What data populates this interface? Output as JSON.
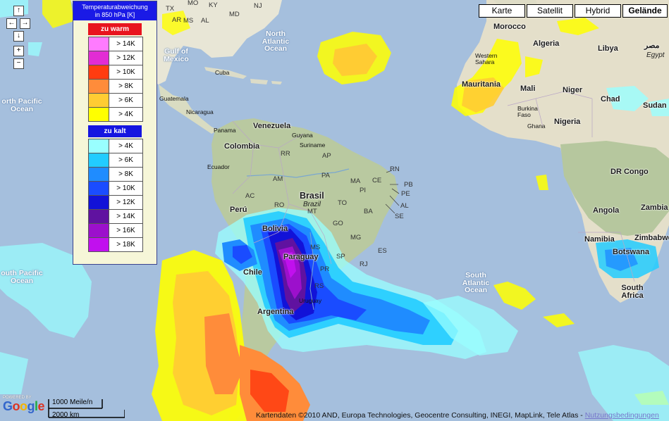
{
  "map_type_buttons": [
    {
      "label": "Karte",
      "selected": false
    },
    {
      "label": "Satellit",
      "selected": false
    },
    {
      "label": "Hybrid",
      "selected": false
    },
    {
      "label": "Gelände",
      "selected": true
    }
  ],
  "nav_controls": {
    "up": "↑",
    "left": "←",
    "right": "→",
    "down": "↓",
    "zoom_in": "+",
    "zoom_out": "−"
  },
  "legend": {
    "title_line1": "Temperaturabweichung",
    "title_line2": "in 850 hPa [K]",
    "warm_header": "zu warm",
    "warm_header_color": "#e8141e",
    "warm_rows": [
      {
        "label": "> 14K",
        "color": "#ff7bff"
      },
      {
        "label": "> 12K",
        "color": "#e22cd4"
      },
      {
        "label": "> 10K",
        "color": "#ff3c10"
      },
      {
        "label": "> 8K",
        "color": "#ff8c3a"
      },
      {
        "label": "> 6K",
        "color": "#ffcc33"
      },
      {
        "label": "> 4K",
        "color": "#ffff00"
      }
    ],
    "cold_header": "zu kalt",
    "cold_header_color": "#1515e0",
    "cold_rows": [
      {
        "label": "> 4K",
        "color": "#99ffff"
      },
      {
        "label": "> 6K",
        "color": "#22ccff"
      },
      {
        "label": "> 8K",
        "color": "#1f8cff"
      },
      {
        "label": "> 10K",
        "color": "#1a4cff"
      },
      {
        "label": "> 12K",
        "color": "#1212d8"
      },
      {
        "label": "> 14K",
        "color": "#6012a0"
      },
      {
        "label": "> 16K",
        "color": "#9c10cc"
      },
      {
        "label": "> 18K",
        "color": "#c110ee"
      }
    ]
  },
  "labels": {
    "countries": [
      {
        "id": "venezuela",
        "text": "Venezuela"
      },
      {
        "id": "colombia",
        "text": "Colombia"
      },
      {
        "id": "brasil",
        "text": "Brasil"
      },
      {
        "id": "bolivia",
        "text": "Bolivia"
      },
      {
        "id": "peru",
        "text": "Perú"
      },
      {
        "id": "paraguay",
        "text": "Paraguay"
      },
      {
        "id": "chile",
        "text": "Chile"
      },
      {
        "id": "argentina",
        "text": "Argentina"
      },
      {
        "id": "morocco",
        "text": "Morocco"
      },
      {
        "id": "algeria",
        "text": "Algeria"
      },
      {
        "id": "libya",
        "text": "Libya"
      },
      {
        "id": "mauritania",
        "text": "Mauritania"
      },
      {
        "id": "mali",
        "text": "Mali"
      },
      {
        "id": "niger",
        "text": "Niger"
      },
      {
        "id": "chad",
        "text": "Chad"
      },
      {
        "id": "sudan",
        "text": "Sudan"
      },
      {
        "id": "nigeria",
        "text": "Nigeria"
      },
      {
        "id": "drcongo",
        "text": "DR Congo"
      },
      {
        "id": "angola",
        "text": "Angola"
      },
      {
        "id": "zambia",
        "text": "Zambia"
      },
      {
        "id": "zimbabwe",
        "text": "Zimbabwe"
      },
      {
        "id": "namibia",
        "text": "Namibia"
      },
      {
        "id": "botswana",
        "text": "Botswana"
      },
      {
        "id": "southafrica",
        "text": "South Africa"
      },
      {
        "id": "egypt_ar",
        "text": "مصر"
      }
    ],
    "local_names": [
      {
        "id": "brazil_local",
        "text": "Brazil"
      },
      {
        "id": "egypt_local",
        "text": "Egypt"
      }
    ],
    "oceans": [
      {
        "id": "north_atlantic",
        "text": "North Atlantic Ocean"
      },
      {
        "id": "south_atlantic",
        "text": "South Atlantic Ocean"
      },
      {
        "id": "north_pacific",
        "text": "orth Pacific Ocean"
      },
      {
        "id": "south_pacific",
        "text": "outh Pacific Ocean"
      },
      {
        "id": "gulf_mexico",
        "text": "Gulf of Mexico"
      }
    ],
    "states": [
      "AM",
      "PA",
      "AC",
      "RO",
      "MT",
      "TO",
      "BA",
      "GO",
      "MG",
      "MS",
      "SP",
      "PR",
      "RS",
      "ES",
      "RJ",
      "RN",
      "PB",
      "PE",
      "AL",
      "SE",
      "CE",
      "PI",
      "MA",
      "AP",
      "RR",
      "TX",
      "MO",
      "KY",
      "AL",
      "MS",
      "AR",
      "MD",
      "NJ"
    ],
    "cities": [
      {
        "id": "cuba",
        "text": "Cuba"
      },
      {
        "id": "guatemala",
        "text": "Guatemala"
      },
      {
        "id": "nicaragua",
        "text": "Nicaragua"
      },
      {
        "id": "panama",
        "text": "Panama"
      },
      {
        "id": "ecuador",
        "text": "Ecuador"
      },
      {
        "id": "guyana",
        "text": "Guyana"
      },
      {
        "id": "suriname",
        "text": "Suriname"
      },
      {
        "id": "westernsahara",
        "text": "Western Sahara"
      },
      {
        "id": "burkina",
        "text": "Burkina Faso"
      },
      {
        "id": "ghana",
        "text": "Ghana"
      },
      {
        "id": "uruguay",
        "text": "Uruguay"
      }
    ]
  },
  "google": {
    "powered": "POWERED BY"
  },
  "scale": {
    "miles": "1000 Meile/n",
    "km": "2000 km"
  },
  "attribution": {
    "text": "Kartendaten ©2010 AND, Europa Technologies, Geocentre Consulting, INEGI, MapLink, Tele Atlas - ",
    "link": "Nutzungsbedingungen"
  }
}
